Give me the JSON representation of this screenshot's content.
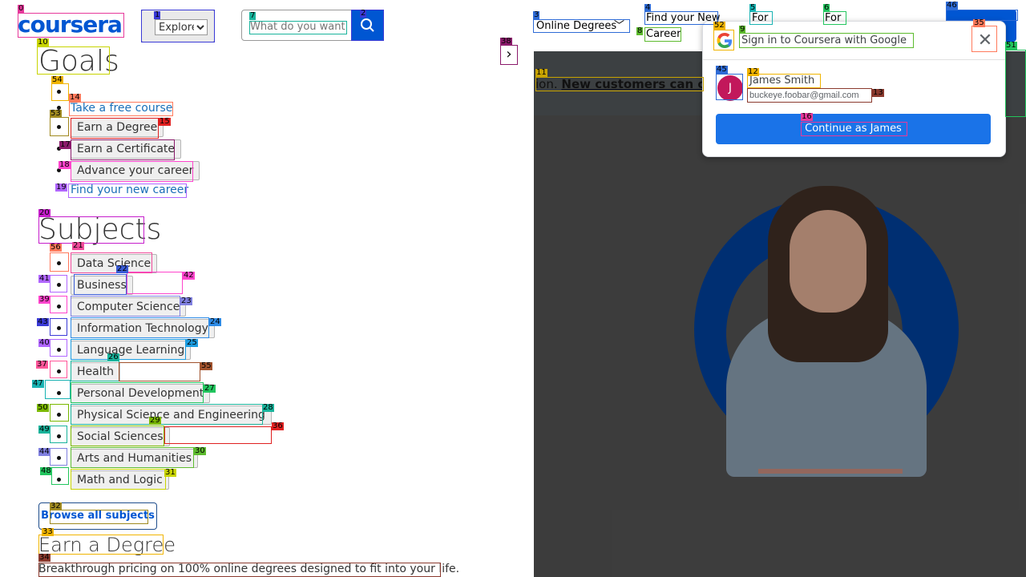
{
  "header": {
    "logo": "coursera",
    "explore": "Explore",
    "search_placeholder": "What do you want",
    "online_degrees": "Online Degrees",
    "find_new_career": "Find your New",
    "career": "Career",
    "for1": "For",
    "for2": "For"
  },
  "announcement": {
    "pre": "ion. ",
    "link": "New customers can cla"
  },
  "goals": {
    "title": "Goals",
    "items": [
      "Take a free course",
      "Earn a Degree",
      "Earn a Certificate",
      "Advance your career",
      "Find your new career"
    ]
  },
  "subjects": {
    "title": "Subjects",
    "items": [
      "Data Science",
      "Business",
      "Computer Science",
      "Information Technology",
      "Language Learning",
      "Health",
      "Personal Development",
      "Physical Science and Engineering",
      "Social Sciences",
      "Arts and Humanities",
      "Math and Logic"
    ],
    "browse": "Browse all subjects"
  },
  "earn_degree": {
    "title": "Earn a Degree",
    "desc": "Breakthrough pricing on 100% online degrees designed to fit into your life."
  },
  "google_popup": {
    "title": "Sign in to Coursera with Google",
    "avatar_letter": "J",
    "name": "James Smith",
    "email": "buckeye.foobar@gmail.com",
    "continue": "Continue as James"
  },
  "marks": [
    "0",
    "1",
    "2",
    "3",
    "4",
    "5",
    "6",
    "7",
    "8",
    "9",
    "10",
    "11",
    "12",
    "13",
    "14",
    "15",
    "16",
    "17",
    "18",
    "19",
    "20",
    "21",
    "22",
    "23",
    "24",
    "25",
    "26",
    "27",
    "28",
    "29",
    "30",
    "31",
    "32",
    "33",
    "34",
    "35",
    "36",
    "37",
    "38",
    "39",
    "40",
    "41",
    "42",
    "43",
    "44",
    "45",
    "46",
    "47",
    "48",
    "49",
    "50",
    "51",
    "52",
    "53",
    "54",
    "55",
    "56"
  ],
  "colors": {
    "brand": "#0056d2",
    "google_blue": "#1a73e8",
    "avatar": "#c2185b"
  }
}
